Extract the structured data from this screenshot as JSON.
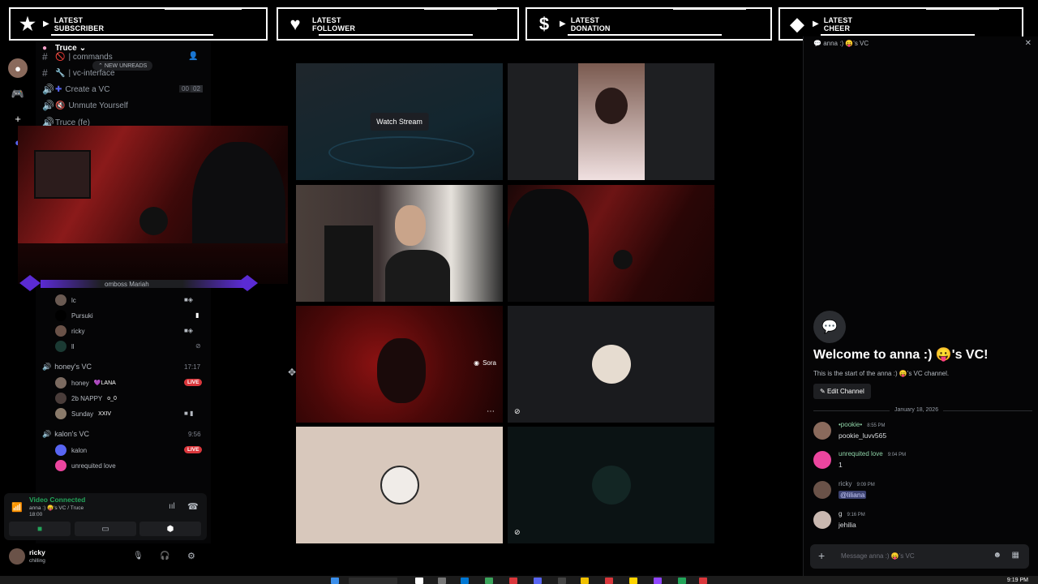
{
  "alerts": [
    {
      "line1": "LATEST",
      "line2": "SUBSCRIBER",
      "icon": "star-icon"
    },
    {
      "line1": "LATEST",
      "line2": "FOLLOWER",
      "icon": "heart-icon"
    },
    {
      "line1": "LATEST",
      "line2": "DONATION",
      "icon": "dollar-icon"
    },
    {
      "line1": "LATEST",
      "line2": "CHEER",
      "icon": "diamond-icon"
    }
  ],
  "server": {
    "name": "Truce"
  },
  "channels": {
    "commands": "| commands",
    "new_unreads": "NEW UNREADS",
    "vc_interface": "| vc-interface",
    "create_vc": "Create a VC",
    "create_vc_count1": "00",
    "create_vc_count2": "02",
    "unmute": "Unmute Yourself",
    "truce_fe": "Truce (fe)"
  },
  "popout": {
    "label": "omboss Mariah"
  },
  "vc_users_top": [
    {
      "name": "lc"
    },
    {
      "name": "Pursuki"
    },
    {
      "name": "ricky"
    },
    {
      "name": "ll"
    }
  ],
  "honeys_vc": {
    "name": "honey's VC",
    "time": "17:17",
    "users": [
      {
        "name": "honey",
        "tag": "💜LANA",
        "live": "LIVE"
      },
      {
        "name": "2b NAPPY",
        "tag": "o_0"
      },
      {
        "name": "Sunday",
        "tag": "XXIV"
      }
    ]
  },
  "kalons_vc": {
    "name": "kalon's VC",
    "time": "9:56",
    "users": [
      {
        "name": "kalon",
        "live": "LIVE"
      },
      {
        "name": "unrequited love"
      }
    ]
  },
  "grid": {
    "watch_stream": "Watch Stream",
    "sora": "Sora"
  },
  "voice_panel": {
    "status": "Video Connected",
    "sub": "anna :) 😛's VC / Truce",
    "time": "18:00"
  },
  "user": {
    "name": "ricky",
    "status": "chilling"
  },
  "chat": {
    "header": "anna :) 😛's VC",
    "welcome": "Welcome to anna :) 😛's VC!",
    "sub": "This is the start of the anna :) 😛's VC channel.",
    "edit_channel": "Edit Channel",
    "date": "January 18, 2026",
    "messages": [
      {
        "name": "•pookie•",
        "time": "8:55 PM",
        "text": "pookie_luvv565",
        "color": "#8fd4a8"
      },
      {
        "name": "unrequited love",
        "time": "9:04 PM",
        "text": "1",
        "color": "#8fd4a8"
      },
      {
        "name": "ricky",
        "time": "9:09 PM",
        "text": "@liliana",
        "color": "#949ba4"
      },
      {
        "name": "g",
        "time": "9:16 PM",
        "text": "jehilia",
        "color": "#dbdee1"
      }
    ],
    "placeholder": "Message anna :) 😛's VC"
  },
  "taskbar": {
    "clock": "9:19 PM"
  },
  "colors": {
    "live": "#da373c",
    "connected": "#23a55a",
    "blurple": "#5865f2"
  }
}
